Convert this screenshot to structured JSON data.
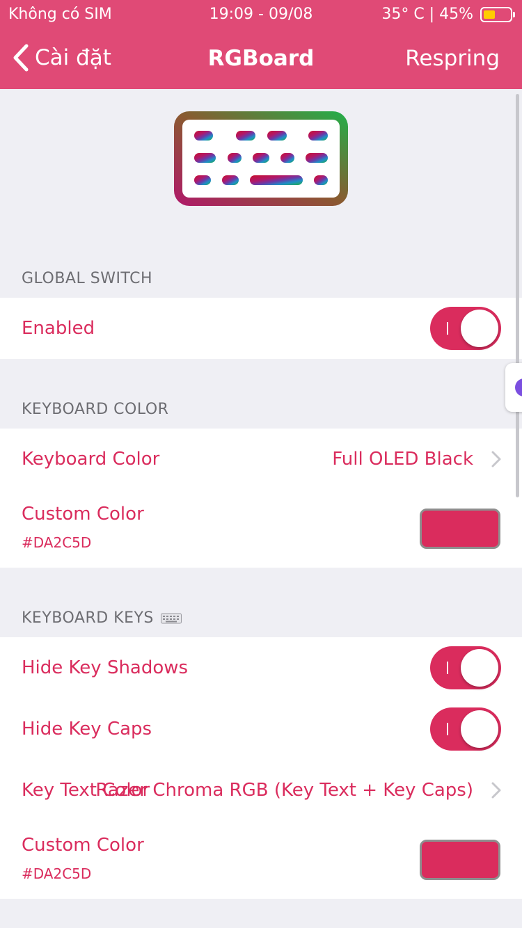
{
  "status_bar": {
    "carrier": "Không có SIM",
    "time": "19:09 - 09/08",
    "temp_battery": "35° C | 45%",
    "battery_level": 0.45
  },
  "nav": {
    "back_label": "Cài đặt",
    "title": "RGBoard",
    "action_label": "Respring"
  },
  "sections": {
    "global_switch": {
      "title": "GLOBAL SWITCH",
      "enabled_label": "Enabled",
      "enabled_on": true
    },
    "keyboard_color": {
      "title": "KEYBOARD COLOR",
      "keyboard_color_label": "Keyboard Color",
      "keyboard_color_value": "Full OLED Black",
      "custom_color_label": "Custom Color",
      "custom_color_hex": "#DA2C5D"
    },
    "keyboard_keys": {
      "title": "KEYBOARD KEYS",
      "hide_shadows_label": "Hide Key Shadows",
      "hide_shadows_on": true,
      "hide_caps_label": "Hide Key Caps",
      "hide_caps_on": true,
      "key_text_color_label": "Key Text Color",
      "key_text_color_value": "Razer Chroma RGB (Key Text + Key Caps)",
      "custom_color_label": "Custom Color",
      "custom_color_hex": "#DA2C5D"
    }
  },
  "colors": {
    "accent": "#da2c5d",
    "navbar": "#e04a76",
    "background": "#efeff4"
  },
  "icons": [
    "chevron-left-icon",
    "battery-icon",
    "keyboard-logo-icon",
    "keyboard-emoji-icon",
    "chevron-right-icon"
  ]
}
